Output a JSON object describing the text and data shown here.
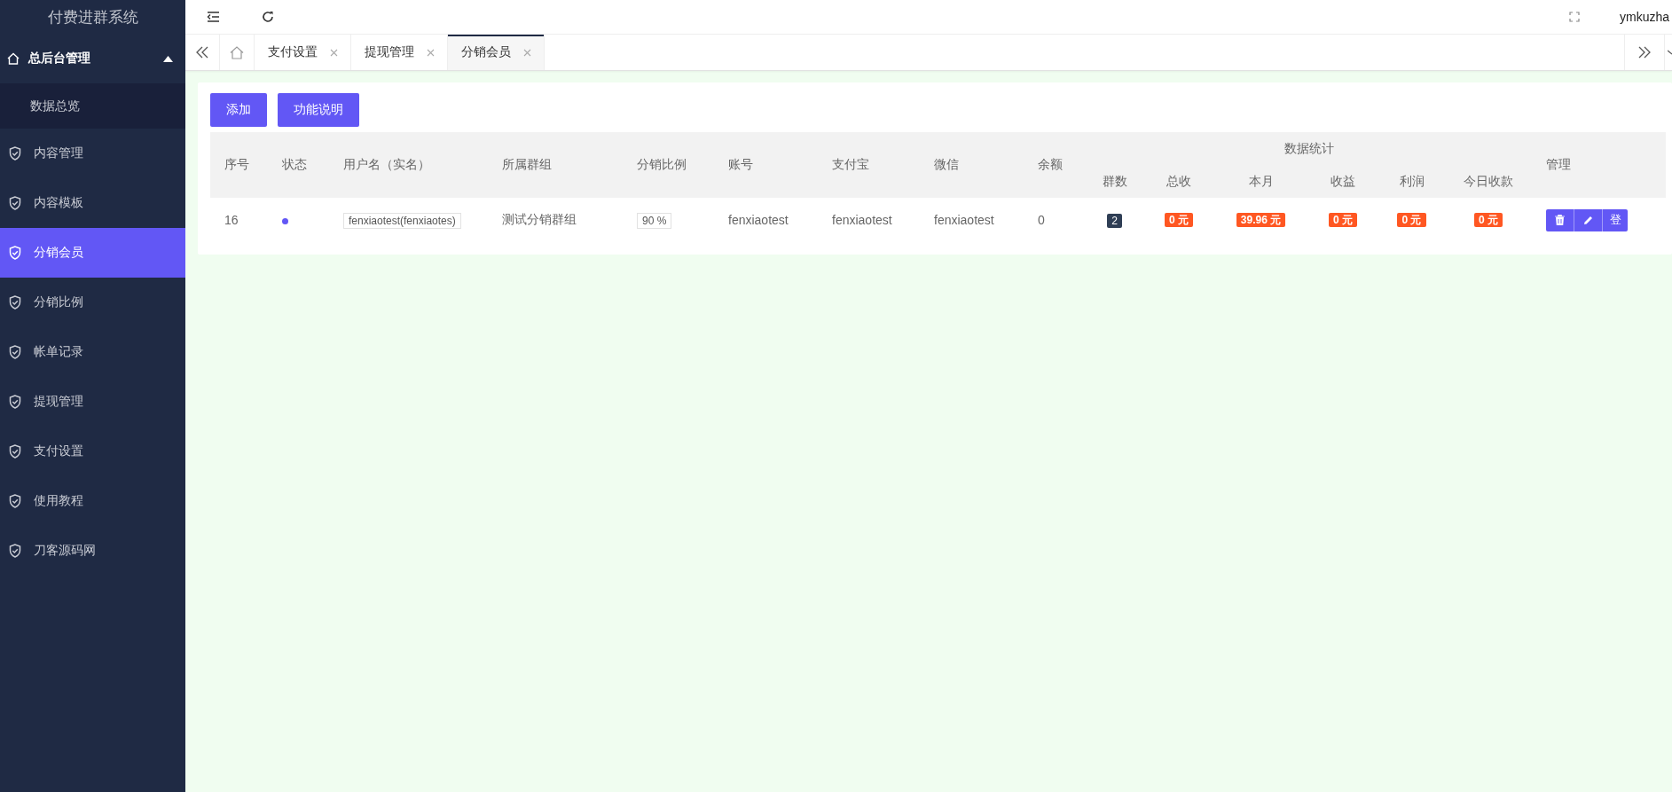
{
  "app_title": "付费进群系统",
  "header": {
    "user": "ymkuzha"
  },
  "sidebar": {
    "group": {
      "label": "总后台管理",
      "expanded": true,
      "children": [
        {
          "label": "数据总览",
          "selected": false
        }
      ]
    },
    "items": [
      {
        "label": "内容管理",
        "selected": false
      },
      {
        "label": "内容模板",
        "selected": false
      },
      {
        "label": "分销会员",
        "selected": true
      },
      {
        "label": "分销比例",
        "selected": false
      },
      {
        "label": "帐单记录",
        "selected": false
      },
      {
        "label": "提现管理",
        "selected": false
      },
      {
        "label": "支付设置",
        "selected": false
      },
      {
        "label": "使用教程",
        "selected": false
      },
      {
        "label": "刀客源码网",
        "selected": false
      }
    ]
  },
  "tabs": [
    {
      "label": "支付设置",
      "selected": false
    },
    {
      "label": "提现管理",
      "selected": false
    },
    {
      "label": "分销会员",
      "selected": true
    }
  ],
  "toolbar": [
    "添加",
    "功能说明"
  ],
  "table": {
    "columns": [
      {
        "label": "序号"
      },
      {
        "label": "状态"
      },
      {
        "label": "用户名（实名）"
      },
      {
        "label": "所属群组"
      },
      {
        "label": "分销比例"
      },
      {
        "label": "账号"
      },
      {
        "label": "支付宝"
      },
      {
        "label": "微信"
      },
      {
        "label": "余额"
      },
      {
        "label": "数据统计",
        "colspan": 6,
        "children": [
          {
            "label": "群数"
          },
          {
            "label": "总收"
          },
          {
            "label": "本月"
          },
          {
            "label": "收益"
          },
          {
            "label": "利润"
          },
          {
            "label": "今日收款"
          }
        ]
      },
      {
        "label": "管理"
      }
    ],
    "rows": [
      {
        "cells": [
          {
            "kind": "text",
            "text": "16"
          },
          {
            "kind": "dot",
            "on": true
          },
          {
            "kind": "tag",
            "text": "fenxiaotest(fenxiaotes)"
          },
          {
            "kind": "text",
            "text": "测试分销群组"
          },
          {
            "kind": "tag",
            "text": "90 %"
          },
          {
            "kind": "text",
            "text": "fenxiaotest"
          },
          {
            "kind": "text",
            "text": "fenxiaotest"
          },
          {
            "kind": "text",
            "text": "fenxiaotest"
          },
          {
            "kind": "text",
            "text": "0"
          },
          {
            "kind": "dark",
            "text": "2"
          },
          {
            "kind": "money",
            "text": "0 元"
          },
          {
            "kind": "money",
            "text": "39.96 元"
          },
          {
            "kind": "money",
            "text": "0 元"
          },
          {
            "kind": "money",
            "text": "0 元"
          },
          {
            "kind": "money",
            "text": "0 元"
          },
          {
            "kind": "actions",
            "actions": [
              {
                "kind": "delete"
              },
              {
                "kind": "edit"
              },
              {
                "kind": "text",
                "label": "登"
              }
            ]
          }
        ]
      }
    ]
  }
}
